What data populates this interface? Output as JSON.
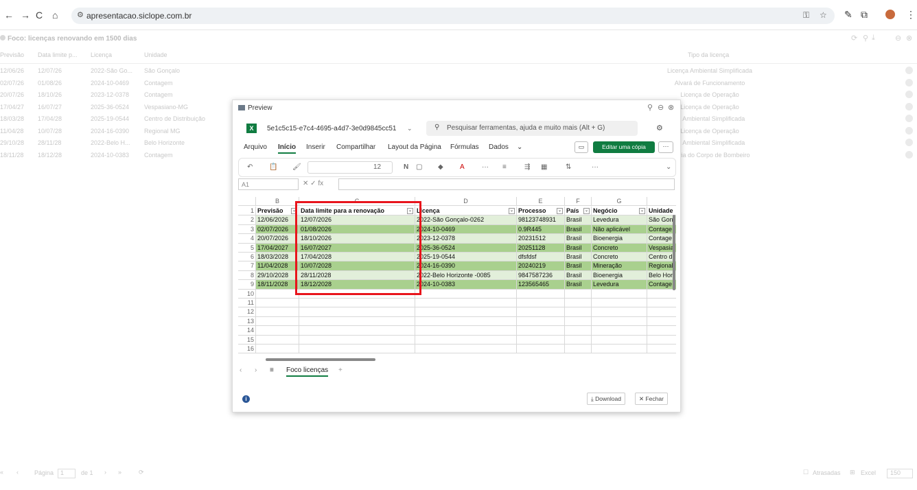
{
  "browser": {
    "url": "apresentacao.siclope.com.br",
    "nav": [
      "←",
      "→",
      "C",
      "⌂"
    ]
  },
  "background": {
    "title": "Foco: licenças renovando em 1500 dias",
    "columns": [
      "Previsão",
      "Data limite p...",
      "Licença",
      "Unidade",
      "Tipo da licença"
    ],
    "rows": [
      [
        "12/06/26",
        "12/07/26",
        "2022-São Go...",
        "São Gonçalo",
        "Licença Ambiental Simplificada"
      ],
      [
        "02/07/26",
        "01/08/26",
        "2024-10-0469",
        "Contagem",
        "Alvará de Funcionamento"
      ],
      [
        "20/07/26",
        "18/10/26",
        "2023-12-0378",
        "Contagem",
        "Licença de Operação"
      ],
      [
        "17/04/27",
        "16/07/27",
        "2025-36-0524",
        "Vespasiano-MG",
        "Licença de Operação"
      ],
      [
        "18/03/28",
        "17/04/28",
        "2025-19-0544",
        "Centro de Distribuição",
        "ça Ambiental Simplificada"
      ],
      [
        "11/04/28",
        "10/07/28",
        "2024-16-0390",
        "Regional MG",
        "Licença de Operação"
      ],
      [
        "29/10/28",
        "28/11/28",
        "2022-Belo H...",
        "Belo Horizonte",
        "ça Ambiental Simplificada"
      ],
      [
        "18/11/28",
        "18/12/28",
        "2024-10-0383",
        "Contagem",
        "istoria do Corpo de Bombeiro"
      ]
    ],
    "footer": {
      "page_label": "Página",
      "page_value": "1",
      "of_label": "de 1",
      "atrasadas": "Atrasadas",
      "excel": "Excel",
      "page_size": "150"
    }
  },
  "preview": {
    "title": "Preview",
    "filename": "5e1c5c15-e7c4-4695-a4d7-3e0d9845cc51",
    "search_placeholder": "Pesquisar ferramentas, ajuda e muito mais (Alt + G)",
    "menu": [
      "Arquivo",
      "Início",
      "Inserir",
      "Compartilhar",
      "Layout da Página",
      "Fórmulas",
      "Dados"
    ],
    "edit_copy": "Editar uma cópia",
    "font_size": "12",
    "name_box": "A1",
    "col_letters": [
      "B",
      "C",
      "D",
      "E",
      "F",
      "G"
    ],
    "headers": [
      "Previsão",
      "Data limite para a renovação",
      "Licença",
      "Processo",
      "País",
      "Negócio",
      "Unidade"
    ],
    "rows": [
      [
        "12/06/2026",
        "12/07/2026",
        "2022-São Gonçalo-0262",
        "98123748931",
        "Brasil",
        "Levedura",
        "São Gon"
      ],
      [
        "02/07/2026",
        "01/08/2026",
        "2024-10-0469",
        "0.9R445",
        "Brasil",
        "Não aplicável",
        "Contage"
      ],
      [
        "20/07/2026",
        "18/10/2026",
        "2023-12-0378",
        "20231512",
        "Brasil",
        "Bioenergia",
        "Contage"
      ],
      [
        "17/04/2027",
        "16/07/2027",
        "2025-36-0524",
        "20251128",
        "Brasil",
        "Concreto",
        "Vespasia"
      ],
      [
        "18/03/2028",
        "17/04/2028",
        "2025-19-0544",
        "dfsfdsf",
        "Brasil",
        "Concreto",
        "Centro d"
      ],
      [
        "11/04/2028",
        "10/07/2028",
        "2024-16-0390",
        "20240219",
        "Brasil",
        "Mineração",
        "Regional"
      ],
      [
        "29/10/2028",
        "28/11/2028",
        "2022-Belo Horizonte -0085",
        "9847587236",
        "Brasil",
        "Bioenergia",
        "Belo Hor"
      ],
      [
        "18/11/2028",
        "18/12/2028",
        "2024-10-0383",
        "123565465",
        "Brasil",
        "Levedura",
        "Contage"
      ]
    ],
    "row_numbers": [
      "1",
      "2",
      "3",
      "4",
      "5",
      "6",
      "7",
      "8",
      "9",
      "10",
      "11",
      "12",
      "13",
      "14",
      "15",
      "16"
    ],
    "sheet_tab": "Foco licenças",
    "download": "Download",
    "close": "Fechar"
  },
  "colors": {
    "excel_green": "#107c41",
    "row_light": "#e2efda",
    "row_dark": "#a9d08e",
    "highlight": "#e8141c"
  }
}
